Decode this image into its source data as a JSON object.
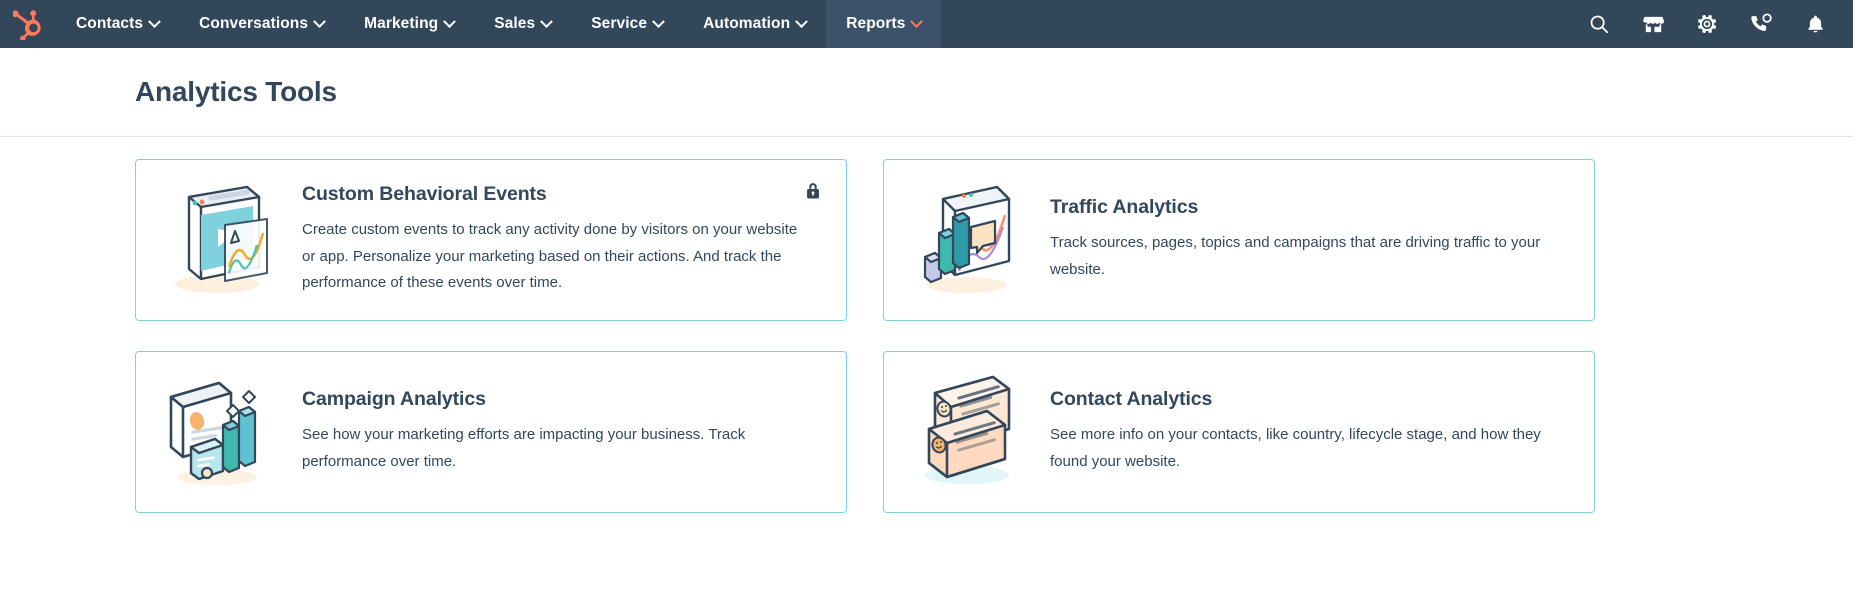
{
  "nav": {
    "logo_icon": "hubspot-sprocket-logo",
    "items": [
      {
        "label": "Contacts",
        "icon": "chevron-down-icon",
        "active": false
      },
      {
        "label": "Conversations",
        "icon": "chevron-down-icon",
        "active": false
      },
      {
        "label": "Marketing",
        "icon": "chevron-down-icon",
        "active": false
      },
      {
        "label": "Sales",
        "icon": "chevron-down-icon",
        "active": false
      },
      {
        "label": "Service",
        "icon": "chevron-down-icon",
        "active": false
      },
      {
        "label": "Automation",
        "icon": "chevron-down-icon",
        "active": false
      },
      {
        "label": "Reports",
        "icon": "chevron-down-icon",
        "active": true
      }
    ],
    "right_icons": [
      {
        "name": "search-icon"
      },
      {
        "name": "marketplace-storefront-icon"
      },
      {
        "name": "settings-gear-icon"
      },
      {
        "name": "phone-call-icon"
      },
      {
        "name": "notifications-bell-icon"
      }
    ]
  },
  "header": {
    "title": "Analytics Tools"
  },
  "cards": [
    {
      "title": "Custom Behavioral Events",
      "description": "Create custom events to track any activity done by visitors on your website or app. Personalize your marketing based on their actions. And track the performance of these events over time.",
      "illustration": "browser-window-play-chart-illustration",
      "locked": true,
      "lock_icon": "padlock-icon"
    },
    {
      "title": "Traffic Analytics",
      "description": "Track sources, pages, topics and campaigns that are driving traffic to your website.",
      "illustration": "bar-chart-laptop-illustration",
      "locked": false,
      "lock_icon": ""
    },
    {
      "title": "Campaign Analytics",
      "description": "See how your marketing efforts are impacting your business. Track performance over time.",
      "illustration": "monitor-bar-chart-illustration",
      "locked": false,
      "lock_icon": ""
    },
    {
      "title": "Contact Analytics",
      "description": "See more info on your contacts, like country, lifecycle stage, and how they found your website.",
      "illustration": "contact-list-laptop-illustration",
      "locked": false,
      "lock_icon": ""
    }
  ],
  "colors": {
    "nav_background": "#33475b",
    "nav_active_background": "#3c5268",
    "accent_orange": "#ff7a59",
    "card_border": "#7fd1de",
    "text_primary": "#33475b",
    "divider": "#dfe3eb"
  }
}
